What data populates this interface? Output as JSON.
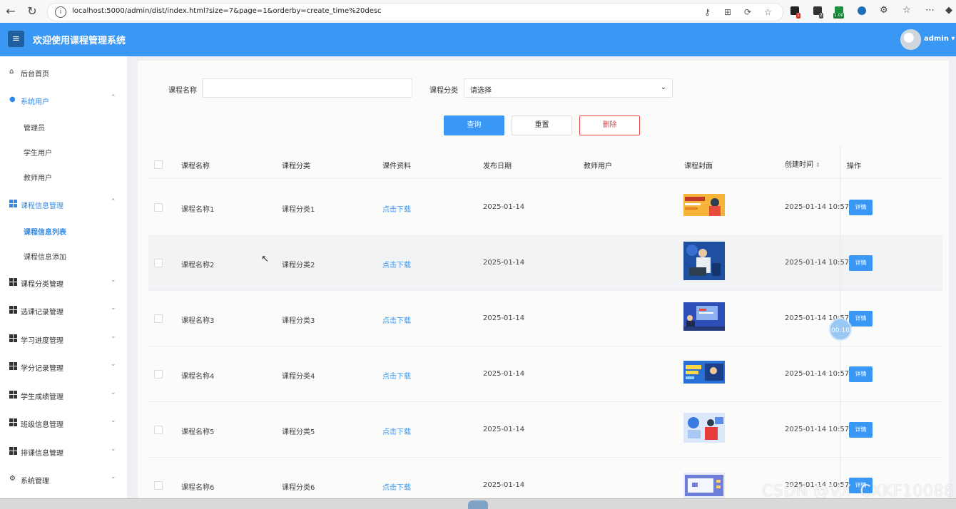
{
  "browser": {
    "url": "localhost:5000/admin/dist/index.html?size=7&page=1&orderby=create_time%20desc",
    "ext_badges": [
      "1",
      "2",
      "1.00"
    ]
  },
  "header": {
    "title": "欢迎使用课程管理系统",
    "user": "admin"
  },
  "sidebar": {
    "items": [
      {
        "label": "后台首页",
        "icon": "home-icon"
      },
      {
        "label": "系统用户",
        "icon": "user-icon",
        "expanded": true,
        "children": [
          "管理员",
          "学生用户",
          "教师用户"
        ]
      },
      {
        "label": "课程信息管理",
        "icon": "grid-icon",
        "expanded": true,
        "children": [
          "课程信息列表",
          "课程信息添加"
        ],
        "active_child": "课程信息列表"
      },
      {
        "label": "课程分类管理",
        "icon": "grid-icon"
      },
      {
        "label": "选课记录管理",
        "icon": "grid-icon"
      },
      {
        "label": "学习进度管理",
        "icon": "grid-icon"
      },
      {
        "label": "学分记录管理",
        "icon": "grid-icon"
      },
      {
        "label": "学生成绩管理",
        "icon": "grid-icon"
      },
      {
        "label": "班级信息管理",
        "icon": "grid-icon"
      },
      {
        "label": "排课信息管理",
        "icon": "grid-icon"
      },
      {
        "label": "系统管理",
        "icon": "gear-icon"
      }
    ]
  },
  "filters": {
    "course_name_label": "课程名称",
    "course_name_value": "",
    "category_label": "课程分类",
    "category_value": "请选择",
    "search_btn": "查询",
    "reset_btn": "重置",
    "delete_btn": "删除"
  },
  "table": {
    "columns": [
      "课程名称",
      "课程分类",
      "课件资料",
      "发布日期",
      "教师用户",
      "课程封面",
      "创建时间",
      "操作"
    ],
    "rows": [
      {
        "name": "课程名称1",
        "category": "课程分类1",
        "file": "点击下载",
        "date": "2025-01-14",
        "teacher": "",
        "created": "2025-01-14 10:57",
        "action": "详情"
      },
      {
        "name": "课程名称2",
        "category": "课程分类2",
        "file": "点击下载",
        "date": "2025-01-14",
        "teacher": "",
        "created": "2025-01-14 10:57",
        "action": "详情"
      },
      {
        "name": "课程名称3",
        "category": "课程分类3",
        "file": "点击下载",
        "date": "2025-01-14",
        "teacher": "",
        "created": "2025-01-14 10:57",
        "action": "详情"
      },
      {
        "name": "课程名称4",
        "category": "课程分类4",
        "file": "点击下载",
        "date": "2025-01-14",
        "teacher": "",
        "created": "2025-01-14 10:57",
        "action": "详情"
      },
      {
        "name": "课程名称5",
        "category": "课程分类5",
        "file": "点击下载",
        "date": "2025-01-14",
        "teacher": "",
        "created": "2025-01-14 10:57",
        "action": "详情"
      },
      {
        "name": "课程名称6",
        "category": "课程分类6",
        "file": "点击下载",
        "date": "2025-01-14",
        "teacher": "",
        "created": "2025-01-14 10:57",
        "action": "详情"
      }
    ]
  },
  "overlay": {
    "timer": "00:10",
    "watermark": "CSDN @VX_CXKF10088"
  },
  "colors": {
    "primary": "#3a98f4",
    "danger": "#e84545"
  }
}
